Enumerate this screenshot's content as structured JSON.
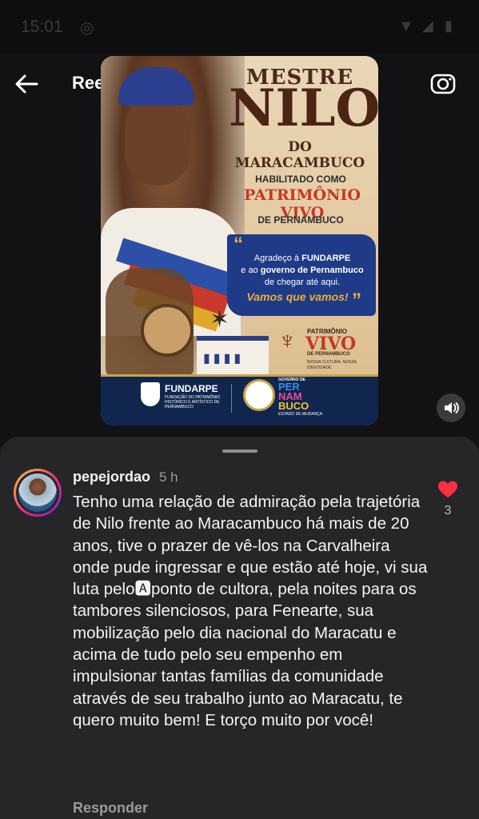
{
  "status_bar": {
    "time": "15:01"
  },
  "app_bar": {
    "title": "Reels"
  },
  "reel": {
    "mestre": "MESTRE",
    "nilo": "NILO",
    "maracambuco": "DO MARACAMBUCO",
    "habilitado": "HABILITADO COMO",
    "patrimonio": "PATRIMÔNIO VIVO",
    "de_pernambuco": "DE PERNAMBUCO",
    "quote_line1": "Agradeço à ",
    "quote_bold1": "FUNDARPE",
    "quote_line2": "e ao ",
    "quote_bold2": "governo de Pernambuco",
    "quote_line3": "de chegar até aqui.",
    "quote_vamos": "Vamos que vamos!",
    "pv_small": "PATRIMÔNIO",
    "pv_big": "VIVO",
    "pv_sub": "DE PERNAMBUCO",
    "pv_motto": "NOSSA CULTURA. NOSSA IDENTIDADE.",
    "fundarpe": "FUNDARPE",
    "fundarpe_sub": "FUNDAÇÃO DO PATRIMÔNIO HISTÓRICO E ARTÍSTICO DE PERNAMBUCO",
    "gov_small": "GOVERNO DE",
    "gov_per": "PER",
    "gov_nam": "NAM",
    "gov_buco": "BUCO",
    "gov_estado": "ESTADO DE MUDANÇA"
  },
  "comment": {
    "username": "pepejordao",
    "time": "5 h",
    "text": "Tenho uma relação de admiração pela trajetória de Nilo frente ao Maracambuco há mais de 20 anos, tive o prazer de vê-los na Carvalheira onde pude ingressar e que estão até hoje, vi sua luta pelo🅰ponto de cultora, pela noites para os tambores silenciosos, para Fenearte, sua mobilização pelo dia nacional do Maracatu e acima de tudo pelo seu empenho em impulsionar tantas famílias da comunidade através de seu trabalho junto ao Maracatu, te quero muito bem! E torço muito por você!",
    "likes": "3",
    "reply": "Responder"
  },
  "icons": {
    "back": "arrow-left-icon",
    "camera": "camera-icon",
    "volume": "speaker-icon",
    "like": "heart-icon"
  },
  "colors": {
    "like": "#ff3040",
    "sheet_bg": "#262628"
  }
}
